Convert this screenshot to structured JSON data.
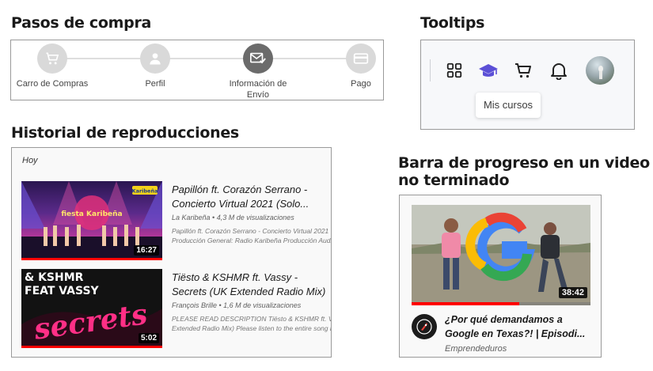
{
  "purchase_steps": {
    "title": "Pasos de compra",
    "steps": [
      {
        "label": "Carro de Compras",
        "icon": "cart-icon",
        "active": false
      },
      {
        "label": "Perfil",
        "icon": "person-icon",
        "active": false
      },
      {
        "label": "Información de Envío",
        "icon": "envelope-check-icon",
        "active": true
      },
      {
        "label": "Pago",
        "icon": "credit-card-icon",
        "active": false
      }
    ]
  },
  "tooltips": {
    "title": "Tooltips",
    "icons": [
      "grid-icon",
      "graduation-cap-icon",
      "cart-icon",
      "bell-icon",
      "avatar"
    ],
    "tooltip_text": "Mis cursos",
    "accent_color": "#5b4fd6"
  },
  "history": {
    "title": "Historial de reproducciones",
    "day_label": "Hoy",
    "videos": [
      {
        "title_line1": "Papillón ft. Corazón Serrano -",
        "title_line2": "Concierto Virtual 2021 (Solo...",
        "meta": "La Karibeña • 4,3 M de visualizaciones",
        "desc_line1": "Papillón ft. Corazón Serrano - Concierto Virtual 2021 (",
        "desc_line2": "Producción General: Radio Karibeña Producción Audio",
        "duration": "16:27",
        "thumb_logo": "Karibeña",
        "thumb_text": "fiesta Karibeña"
      },
      {
        "title_line1": "Tiësto & KSHMR ft. Vassy -",
        "title_line2": "Secrets (UK Extended Radio Mix)",
        "meta": "François Brille • 1,6 M de visualizaciones",
        "desc_line1": "PLEASE READ DESCRIPTION Tiësto & KSHMR ft. Vass",
        "desc_line2": "Extended Radio Mix) Please listen to the entire song b",
        "duration": "5:02",
        "thumb_top_text": "& KSHMR",
        "thumb_sub_text": "FEAT VASSY",
        "thumb_script_text": "secrets"
      }
    ]
  },
  "progress": {
    "title_line1": "Barra de progreso en un video",
    "title_line2": "no terminado",
    "video": {
      "title_line1": "¿Por qué demandamos a",
      "title_line2": "Google en Texas?! | Episodi...",
      "channel": "Emprendeduros",
      "duration": "38:42",
      "watched_fraction": 0.6
    }
  }
}
